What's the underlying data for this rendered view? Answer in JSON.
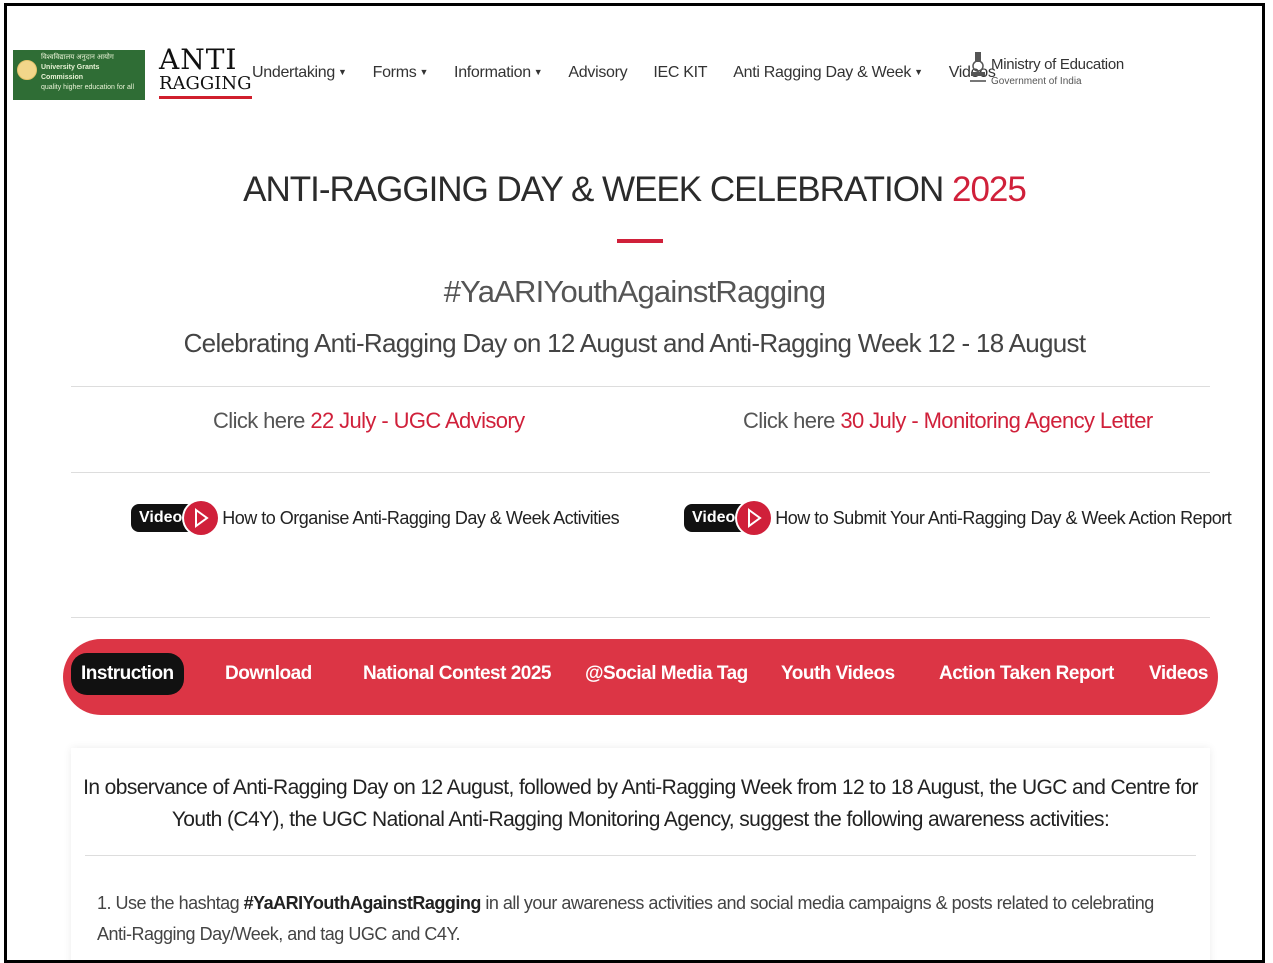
{
  "header": {
    "ugc_logo_text": [
      "विश्वविद्यालय अनुदान आयोग",
      "University Grants Commission",
      "quality higher education for all"
    ],
    "ar_logo": {
      "line1": "ANTI",
      "line2": "RAGGING"
    },
    "nav": [
      {
        "label": "Undertaking",
        "dropdown": true
      },
      {
        "label": "Forms",
        "dropdown": true
      },
      {
        "label": "Information",
        "dropdown": true
      },
      {
        "label": "Advisory",
        "dropdown": false
      },
      {
        "label": "IEC KIT",
        "dropdown": false
      },
      {
        "label": "Anti Ragging Day & Week",
        "dropdown": true
      },
      {
        "label": "Videos",
        "dropdown": false
      }
    ],
    "moe": {
      "title": "Ministry of Education",
      "subtitle": "Government of India"
    }
  },
  "hero": {
    "title": "ANTI-RAGGING DAY & WEEK CELEBRATION",
    "year": "2025",
    "hashtag": "#YaARIYouthAgainstRagging",
    "subtitle": "Celebrating Anti-Ragging Day on 12 August and Anti-Ragging Week 12 - 18 August"
  },
  "links": [
    {
      "prefix": "Click here",
      "highlight": "22 July - UGC Advisory"
    },
    {
      "prefix": "Click here",
      "highlight": "30 July - Monitoring Agency Letter"
    }
  ],
  "videos": [
    {
      "badge": "Video",
      "text": "How to Organise Anti-Ragging Day & Week Activities"
    },
    {
      "badge": "Video",
      "text": "How to Submit Your Anti-Ragging Day & Week Action Report"
    }
  ],
  "tabs": [
    {
      "label": "Instruction",
      "active": true
    },
    {
      "label": "Download",
      "active": false
    },
    {
      "label": "National Contest 2025",
      "active": false
    },
    {
      "label": "@Social Media Tag",
      "active": false
    },
    {
      "label": "Youth Videos",
      "active": false
    },
    {
      "label": "Action Taken Report",
      "active": false
    },
    {
      "label": "Videos",
      "active": false
    }
  ],
  "instruction": {
    "intro": "In observance of Anti-Ragging Day on 12 August, followed by Anti-Ragging Week from 12 to 18 August, the UGC and Centre for Youth (C4Y), the UGC National Anti-Ragging Monitoring Agency, suggest the following awareness activities:",
    "items": [
      {
        "number": "1.",
        "pre": "Use the hashtag",
        "tag": "#YaARIYouthAgainstRagging",
        "post": "in all your awareness activities and social media campaigns & posts related to celebrating Anti-Ragging Day/Week, and tag UGC and C4Y."
      }
    ]
  },
  "colors": {
    "accent": "#dc3545",
    "title_red": "#d0203a",
    "ugc_green": "#2f6d35"
  }
}
